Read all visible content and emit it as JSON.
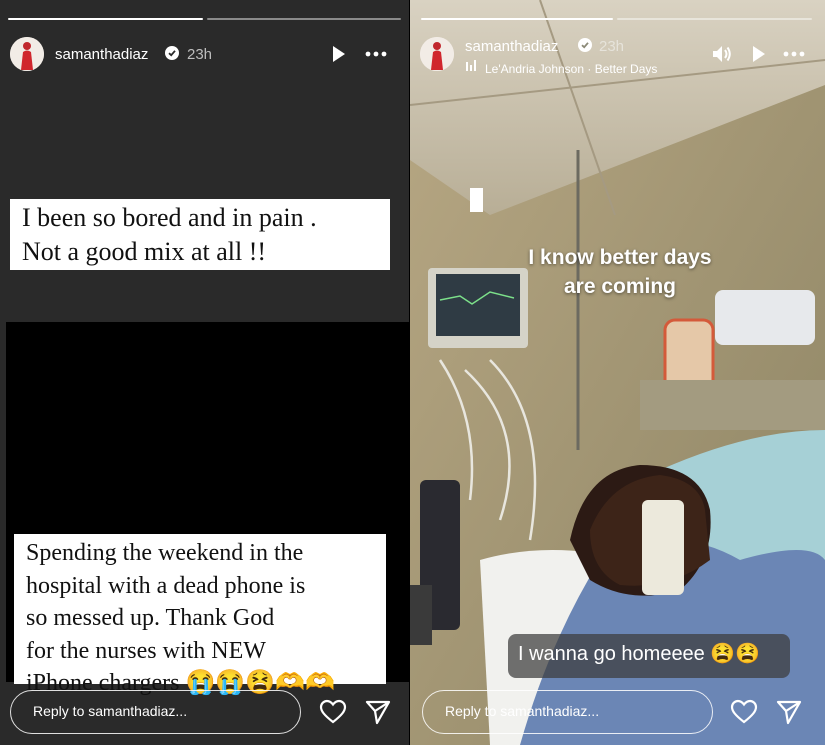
{
  "stories": [
    {
      "username": "samanthadiaz",
      "time": "23h",
      "caption_top": [
        "I been so bored and in pain .",
        "Not a good mix at all !!"
      ],
      "caption_bottom": [
        "Spending the weekend in the",
        "hospital with a dead phone is",
        "so messed up. Thank God",
        "for the nurses with NEW",
        "iPhone chargers 😭😭😫🫶🫶"
      ],
      "reply_placeholder": "Reply to samanthadiaz...",
      "icons": [
        "verified-icon",
        "play-icon",
        "more-icon",
        "heart-icon",
        "send-icon"
      ]
    },
    {
      "username": "samanthadiaz",
      "time": "23h",
      "song": "Le'Andria Johnson · Better Days",
      "overlay_text": [
        "I know better days",
        "are coming"
      ],
      "sticker_text": "I wanna go homeeee 😫😫",
      "reply_placeholder": "Reply to samanthadiaz...",
      "icons": [
        "verified-icon",
        "music-bars-icon",
        "speaker-icon",
        "play-icon",
        "more-icon",
        "heart-icon",
        "send-icon"
      ]
    }
  ],
  "colors": {
    "left_bg": "#2a2a2a",
    "caption_bg": "#ffffff",
    "text_white": "#ffffff"
  }
}
